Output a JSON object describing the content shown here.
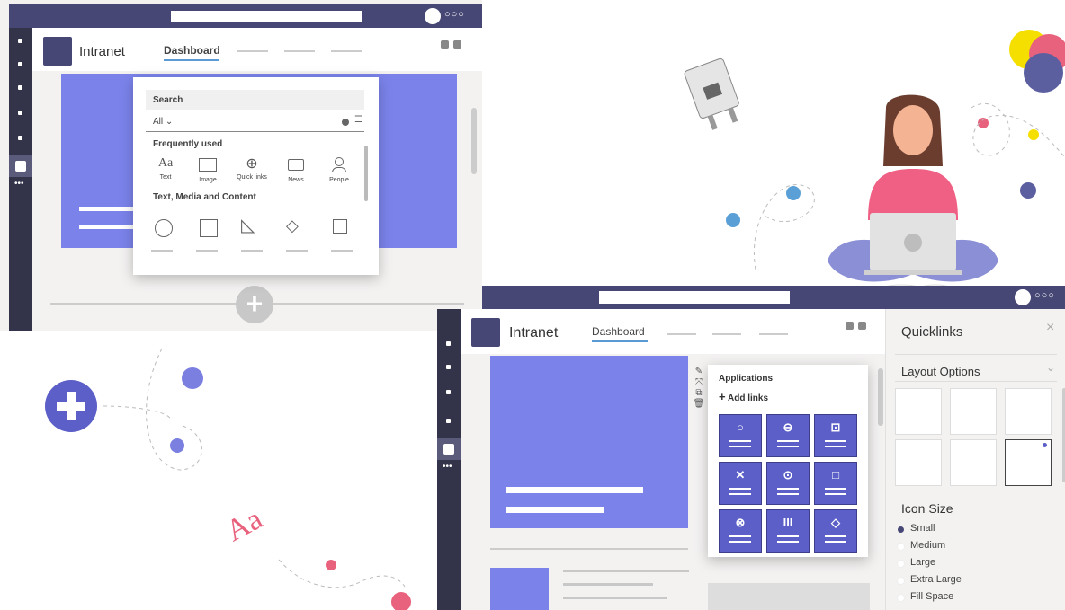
{
  "left_window": {
    "app_title": "Intranet",
    "active_tab": "Dashboard",
    "picker": {
      "search_label": "Search",
      "filter_value": "All",
      "section_frequent": "Frequently used",
      "section_text_media": "Text, Media and Content",
      "items": [
        {
          "icon": "Aa",
          "label": "Text"
        },
        {
          "icon": "image-icon",
          "label": "Image"
        },
        {
          "icon": "globe-icon",
          "label": "Quick links"
        },
        {
          "icon": "news-icon",
          "label": "News"
        },
        {
          "icon": "person-icon",
          "label": "People"
        }
      ]
    }
  },
  "right_window": {
    "app_title": "Intranet",
    "active_tab": "Dashboard",
    "apps_card": {
      "title": "Applications",
      "add_links": "Add links",
      "tile_icons": [
        "○",
        "⊖",
        "⊡",
        "✕",
        "⊙",
        "□",
        "⊗",
        "III",
        "◇"
      ]
    },
    "side_panel": {
      "title": "Quicklinks",
      "layout_options": "Layout Options",
      "icon_size": "Icon Size",
      "sizes": [
        "Small",
        "Medium",
        "Large",
        "Extra Large",
        "Fill Space"
      ],
      "selected_size": "Small"
    }
  },
  "decorations": {
    "aa_text": "Aa"
  },
  "colors": {
    "topbar": "#464775",
    "rail": "#33344a",
    "accent": "#5b5fc7",
    "hero": "#7b83eb",
    "pink": "#e8627d",
    "yellow": "#f5df00"
  }
}
